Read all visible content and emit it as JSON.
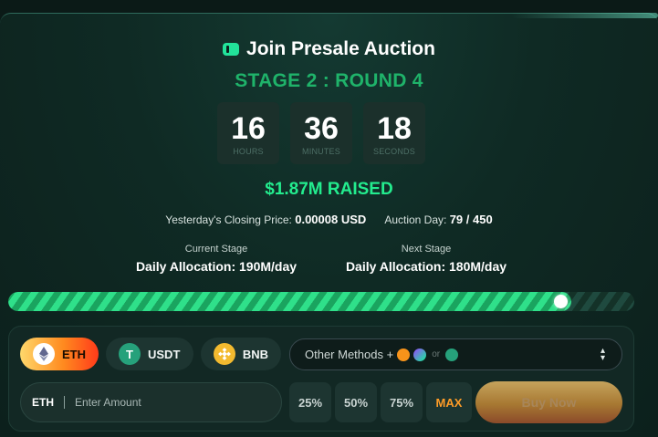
{
  "header": {
    "title": "Join Presale Auction",
    "stage": "STAGE 2 : ROUND 4"
  },
  "timer": {
    "hours": "16",
    "hours_label": "HOURS",
    "minutes": "36",
    "minutes_label": "MINUTES",
    "seconds": "18",
    "seconds_label": "SECONDS"
  },
  "raised": "$1.87M RAISED",
  "prices": {
    "closing_label": "Yesterday's Closing Price:",
    "closing_value": "0.00008 USD",
    "day_label": "Auction Day:",
    "day_value": "79 / 450"
  },
  "current_stage": {
    "label": "Current Stage",
    "alloc_label": "Daily Allocation:",
    "alloc_value": "190M/day"
  },
  "next_stage": {
    "label": "Next Stage",
    "alloc_label": "Daily Allocation:",
    "alloc_value": "180M/day"
  },
  "progress": {
    "fraction": 0.9
  },
  "currencies": [
    {
      "label": "ETH",
      "icon": "ethereum-icon",
      "active": true
    },
    {
      "label": "USDT",
      "icon": "tether-icon",
      "active": false
    },
    {
      "label": "BNB",
      "icon": "binance-icon",
      "active": false
    }
  ],
  "other_methods": {
    "label": "Other Methods +",
    "or": "or",
    "icons": [
      "bitcoin-icon",
      "solana-icon",
      "tether-icon"
    ]
  },
  "amount": {
    "currency": "ETH",
    "placeholder": "Enter Amount"
  },
  "percent_buttons": [
    "25%",
    "50%",
    "75%",
    "MAX"
  ],
  "buy_button": "Buy Now",
  "colors": {
    "accent_green": "#23ec8e",
    "stage_green": "#1fb36a",
    "max_orange": "#ff9c27"
  }
}
